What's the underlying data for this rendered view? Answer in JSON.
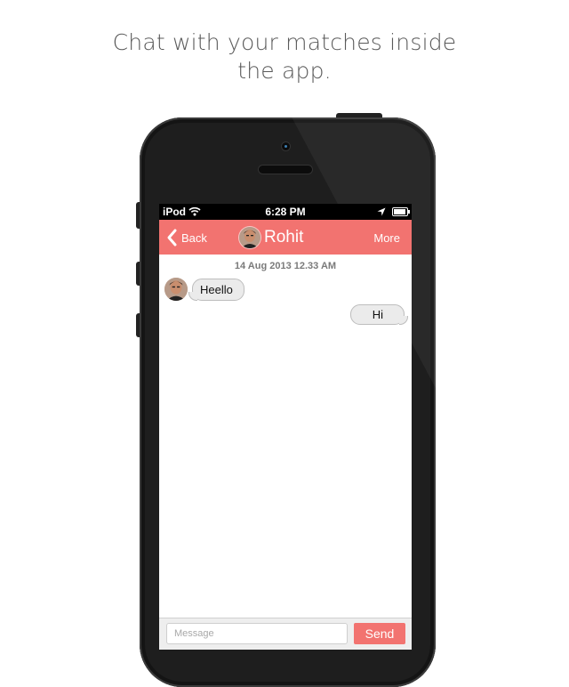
{
  "caption": {
    "line1": "Chat with your matches inside",
    "line2": "the app."
  },
  "status_bar": {
    "carrier": "iPod",
    "time": "6:28 PM",
    "wifi_icon": "wifi-icon",
    "location_icon": "location-arrow-icon",
    "battery_icon": "battery-icon"
  },
  "nav": {
    "back_label": "Back",
    "title": "Rohit",
    "more_label": "More",
    "accent": "#f27370"
  },
  "chat": {
    "timestamp": "14 Aug 2013 12.33 AM",
    "messages": [
      {
        "direction": "incoming",
        "text": "Heello"
      },
      {
        "direction": "outgoing",
        "text": "Hi"
      }
    ]
  },
  "composer": {
    "placeholder": "Message",
    "send_label": "Send"
  }
}
